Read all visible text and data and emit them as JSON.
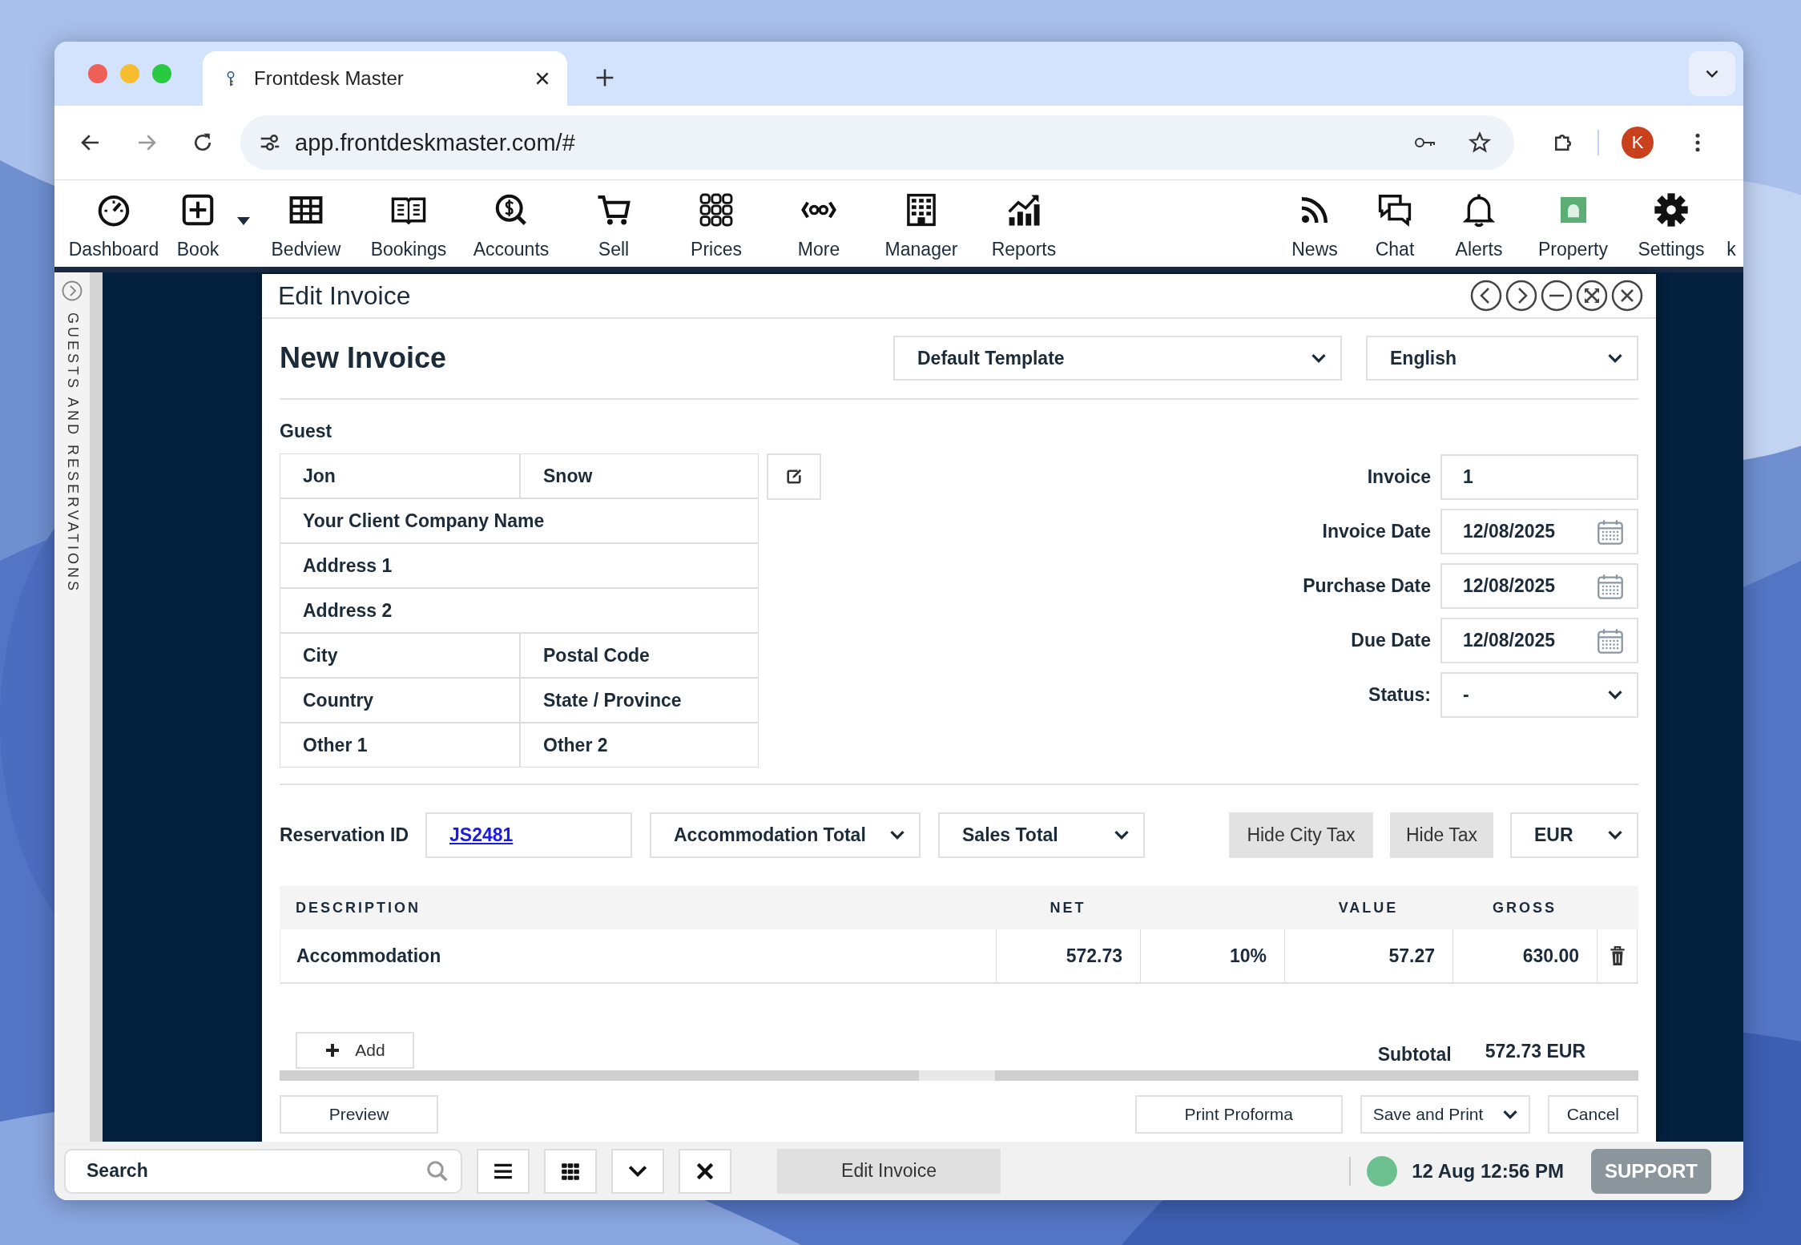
{
  "browser": {
    "tab_title": "Frontdesk Master",
    "url": "app.frontdeskmaster.com/#",
    "profile_initial": "K"
  },
  "toolbar": {
    "left": [
      {
        "label": "Dashboard",
        "dropdown": false
      },
      {
        "label": "Book",
        "dropdown": true
      },
      {
        "label": "Bedview",
        "dropdown": false
      },
      {
        "label": "Bookings",
        "dropdown": false
      },
      {
        "label": "Accounts",
        "dropdown": false
      },
      {
        "label": "Sell",
        "dropdown": false
      },
      {
        "label": "Prices",
        "dropdown": false
      },
      {
        "label": "More",
        "dropdown": false
      },
      {
        "label": "Manager",
        "dropdown": false
      },
      {
        "label": "Reports",
        "dropdown": false
      }
    ],
    "right": [
      {
        "label": "News"
      },
      {
        "label": "Chat"
      },
      {
        "label": "Alerts"
      },
      {
        "label": "Property"
      },
      {
        "label": "Settings"
      },
      {
        "label": "k"
      }
    ]
  },
  "sidebar": {
    "label": "GUESTS AND RESERVATIONS"
  },
  "dialog": {
    "title": "Edit Invoice",
    "heading": "New Invoice",
    "template": "Default Template",
    "language": "English",
    "guest": {
      "label": "Guest",
      "rows": [
        [
          "Jon",
          "Snow"
        ],
        [
          "Your Client Company Name"
        ],
        [
          "Address 1"
        ],
        [
          "Address 2"
        ],
        [
          "City",
          "Postal Code"
        ],
        [
          "Country",
          "State / Province"
        ],
        [
          "Other 1",
          "Other 2"
        ]
      ]
    },
    "invoice_fields": [
      {
        "label": "Invoice",
        "value": "1",
        "kind": "text"
      },
      {
        "label": "Invoice Date",
        "value": "12/08/2025",
        "kind": "date"
      },
      {
        "label": "Purchase Date",
        "value": "12/08/2025",
        "kind": "date"
      },
      {
        "label": "Due Date",
        "value": "12/08/2025",
        "kind": "date"
      },
      {
        "label": "Status:",
        "value": "-",
        "kind": "select"
      }
    ],
    "reservation": {
      "label": "Reservation ID",
      "id": "JS2481",
      "selects": [
        "Accommodation Total",
        "Sales Total"
      ],
      "buttons": [
        "Hide City Tax",
        "Hide Tax"
      ],
      "currency": "EUR"
    },
    "table": {
      "columns": [
        "DESCRIPTION",
        "NET",
        "VALUE",
        "GROSS"
      ],
      "rows": [
        {
          "description": "Accommodation",
          "net": "572.73",
          "tax_rate": "10%",
          "value": "57.27",
          "gross": "630.00"
        }
      ]
    },
    "add_button": "Add",
    "subtotal": {
      "label": "Subtotal",
      "value": "572.73 EUR"
    },
    "footer": {
      "preview": "Preview",
      "print_proforma": "Print Proforma",
      "save_and_print": "Save and Print",
      "cancel": "Cancel"
    }
  },
  "taskbar": {
    "search_placeholder": "Search",
    "task": "Edit Invoice",
    "datetime": "12 Aug 12:56 PM",
    "support": "SUPPORT"
  }
}
